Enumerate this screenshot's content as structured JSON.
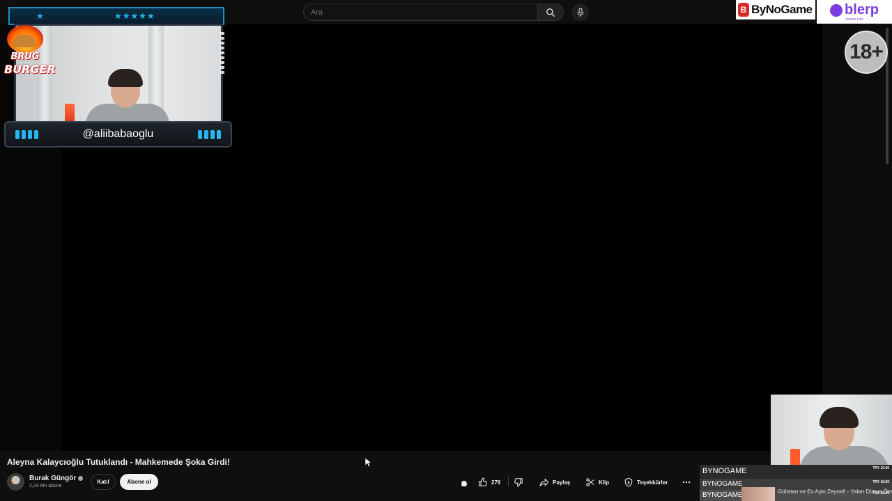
{
  "search": {
    "placeholder": "Ara"
  },
  "sponsors": {
    "bynogame": "ByNoGame",
    "bynogame_mark": "B",
    "blerp": "blerp",
    "blerp_sub": "Viewer Link"
  },
  "age_badge": "18+",
  "overlay": {
    "handle": "@aliibabaoglu",
    "brand_line1": "BRUG",
    "brand_line2": "BURGER"
  },
  "video": {
    "title": "Aleyna Kalaycıoğlu Tutuklandı - Mahkemede Şoka Girdi!",
    "channel": "Burak Güngör",
    "subscribers": "2,24 Mn abone",
    "join_label": "Katıl",
    "subscribe_label": "Abone ol",
    "like_count": "276",
    "share_label": "Paylaş",
    "clip_label": "Klip",
    "thanks_label": "Teşekkürler"
  },
  "donations": [
    {
      "name": "BYNOGAME",
      "amount": "TRY 10.00"
    },
    {
      "name": "BYNOGAME",
      "amount": "TRY 10.00"
    },
    {
      "name": "BYNOGAME",
      "amount": "TRY 10.00",
      "message": "Gülistan ve Ex Aşkı Zeynel! - Yalan Dünya Özel Klip"
    }
  ],
  "icons": {
    "search": "search-icon",
    "mic": "mic-icon",
    "like": "thumb-up-icon",
    "dislike": "thumb-down-icon",
    "share": "share-icon",
    "clip": "scissors-icon",
    "thanks": "thanks-icon",
    "more": "more-icon",
    "extension": "puzzle-icon"
  },
  "colors": {
    "background": "#0f0f0f",
    "player": "#000000",
    "overlay_accent": "#27b4f0",
    "blerp": "#7a3ee0",
    "bynogame_red": "#d92a2a"
  }
}
